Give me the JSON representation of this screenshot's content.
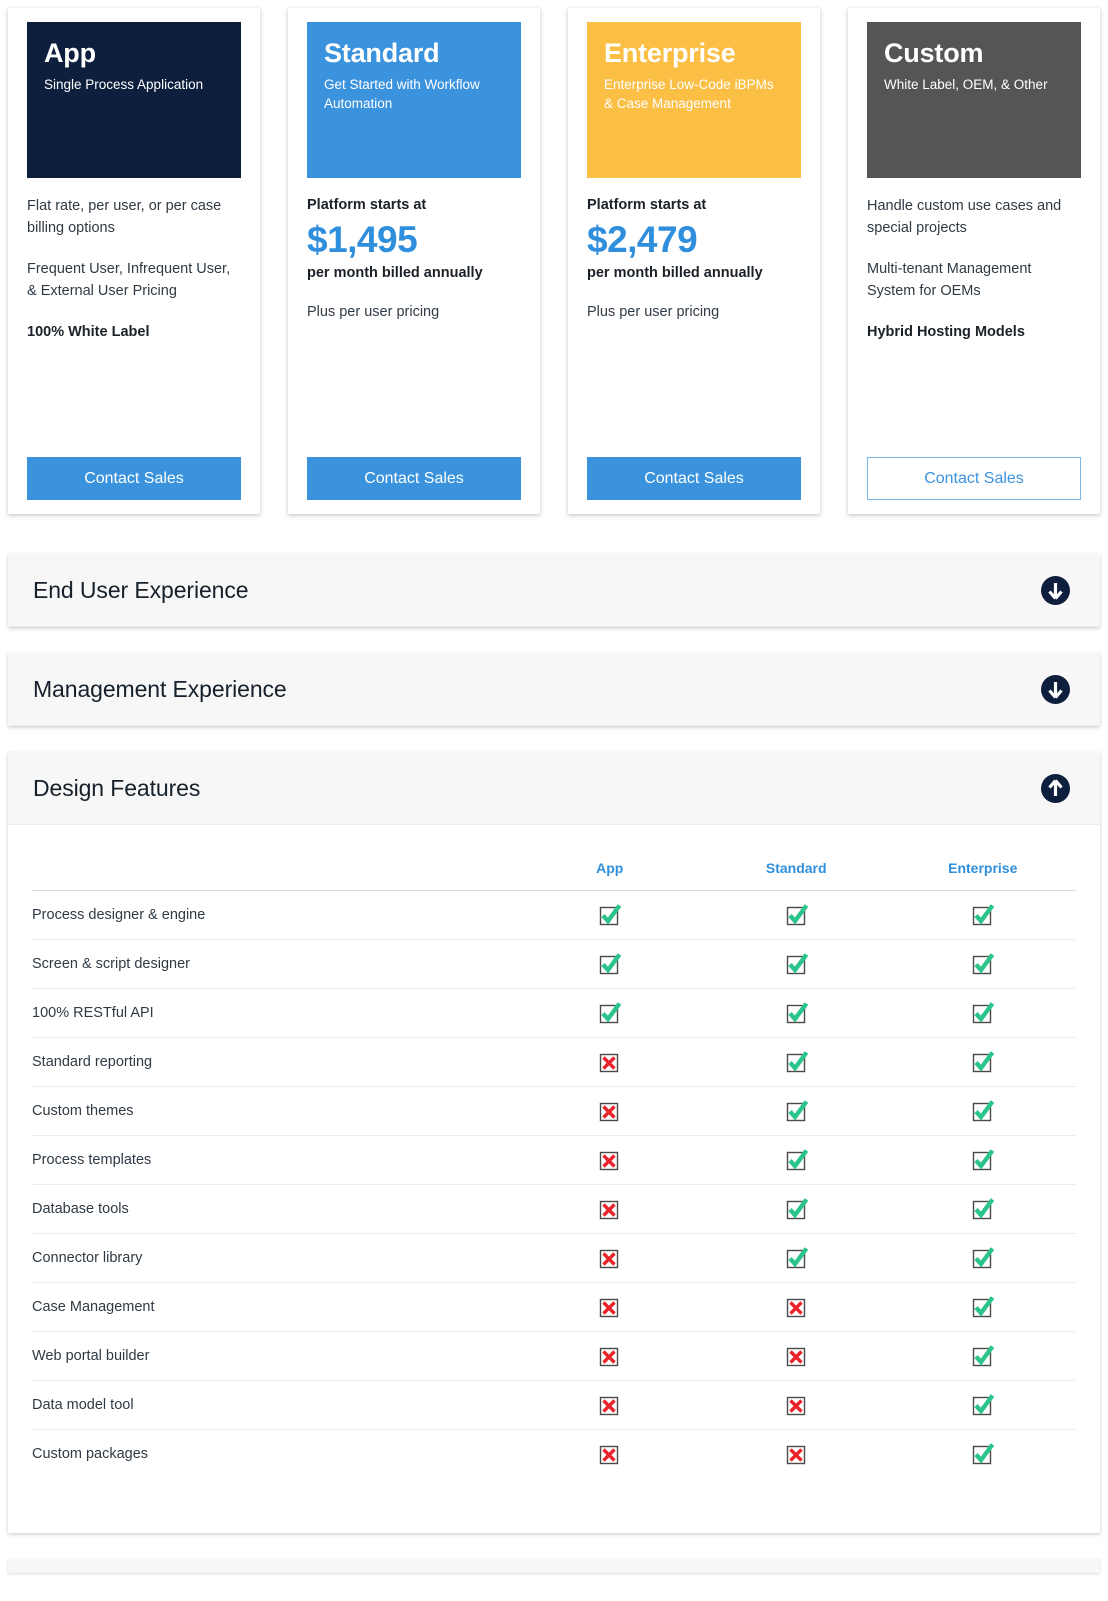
{
  "colors": {
    "app_header_bg": "#0d1f3c",
    "standard_header_bg": "#3b93de",
    "enterprise_header_bg": "#fbbf45",
    "custom_header_bg": "#555555",
    "button_blue": "#3b93de",
    "accent_blue": "#2f8fdd",
    "check_green": "#2bc48a",
    "cross_red": "#e8232a",
    "accordion_icon_bg": "#0d1f3c"
  },
  "plans": [
    {
      "name": "App",
      "tagline": "Single Process Application",
      "header_bg": "#0d1f3c",
      "lines": [
        {
          "text": "Flat rate, per user, or per case billing options",
          "bold": false
        },
        {
          "text": "Frequent User, Infrequent User, & External User Pricing",
          "bold": false
        },
        {
          "text": "100% White Label",
          "bold": true
        }
      ],
      "price_label": "",
      "price_amount": "",
      "price_note": "",
      "price_plus": "",
      "cta_label": "Contact Sales",
      "cta_style": "filled"
    },
    {
      "name": "Standard",
      "tagline": "Get Started with Workflow Automation",
      "header_bg": "#3b93de",
      "lines": [],
      "price_label": "Platform starts at",
      "price_amount": "$1,495",
      "price_note": "per month billed annually",
      "price_plus": "Plus per user pricing",
      "cta_label": "Contact Sales",
      "cta_style": "filled"
    },
    {
      "name": "Enterprise",
      "tagline": "Enterprise Low-Code iBPMs & Case Management",
      "header_bg": "#fbbf45",
      "lines": [],
      "price_label": "Platform starts at",
      "price_amount": "$2,479",
      "price_note": "per month billed annually",
      "price_plus": "Plus per user pricing",
      "cta_label": "Contact Sales",
      "cta_style": "filled"
    },
    {
      "name": "Custom",
      "tagline": "White Label, OEM, & Other",
      "header_bg": "#555555",
      "lines": [
        {
          "text": "Handle custom use cases and special projects",
          "bold": false
        },
        {
          "text": "Multi-tenant Management System for OEMs",
          "bold": false
        },
        {
          "text": "Hybrid Hosting Models",
          "bold": true
        }
      ],
      "price_label": "",
      "price_amount": "",
      "price_note": "",
      "price_plus": "",
      "cta_label": "Contact Sales",
      "cta_style": "outline"
    }
  ],
  "accordions": [
    {
      "title": "End User Experience",
      "expanded": false,
      "icon": "arrow-down-circle-icon"
    },
    {
      "title": "Management Experience",
      "expanded": false,
      "icon": "arrow-down-circle-icon"
    },
    {
      "title": "Design Features",
      "expanded": true,
      "icon": "arrow-up-circle-icon"
    }
  ],
  "feature_table": {
    "columns": [
      "App",
      "Standard",
      "Enterprise"
    ],
    "rows": [
      {
        "feature": "Process designer & engine",
        "values": [
          "check",
          "check",
          "check"
        ]
      },
      {
        "feature": "Screen & script designer",
        "values": [
          "check",
          "check",
          "check"
        ]
      },
      {
        "feature": "100% RESTful API",
        "values": [
          "check",
          "check",
          "check"
        ]
      },
      {
        "feature": "Standard reporting",
        "values": [
          "cross",
          "check",
          "check"
        ]
      },
      {
        "feature": "Custom themes",
        "values": [
          "cross",
          "check",
          "check"
        ]
      },
      {
        "feature": "Process templates",
        "values": [
          "cross",
          "check",
          "check"
        ]
      },
      {
        "feature": "Database tools",
        "values": [
          "cross",
          "check",
          "check"
        ]
      },
      {
        "feature": "Connector library",
        "values": [
          "cross",
          "check",
          "check"
        ]
      },
      {
        "feature": "Case Management",
        "values": [
          "cross",
          "cross",
          "check"
        ]
      },
      {
        "feature": "Web portal builder",
        "values": [
          "cross",
          "cross",
          "check"
        ]
      },
      {
        "feature": "Data model tool",
        "values": [
          "cross",
          "cross",
          "check"
        ]
      },
      {
        "feature": "Custom packages",
        "values": [
          "cross",
          "cross",
          "check"
        ]
      }
    ]
  }
}
